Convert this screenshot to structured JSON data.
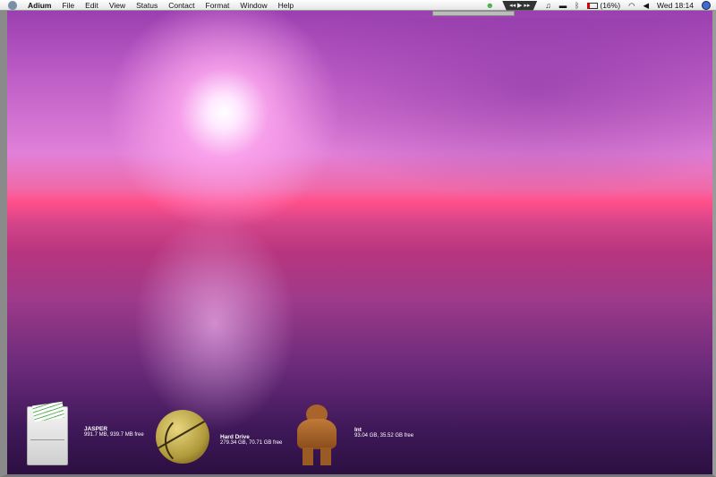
{
  "menubar": {
    "app_name": "Adium",
    "menus": [
      "File",
      "Edit",
      "View",
      "Status",
      "Contact",
      "Format",
      "Window",
      "Help"
    ],
    "media_controls": "◂◂ ▶ ▸▸",
    "battery": "(16%)",
    "clock": "Wed 18:14"
  },
  "desktop": {
    "drives": [
      {
        "name": "JASPER",
        "info": "991.7 MB, 939.7 MB free"
      },
      {
        "name": "Hard Drive",
        "info": "279.34 GB, 70.71 GB free"
      },
      {
        "name": "Int",
        "info": "93.04 GB, 35.52 GB free"
      }
    ]
  }
}
